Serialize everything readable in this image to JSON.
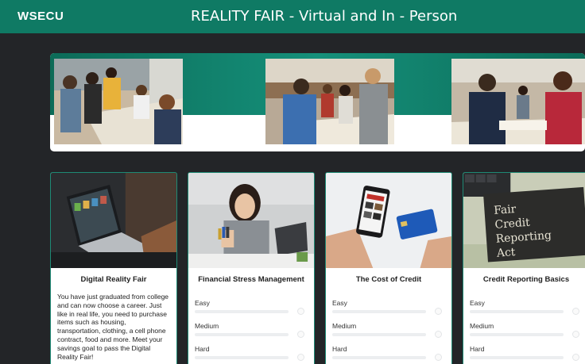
{
  "header": {
    "logo": "WSECU",
    "title": "REALITY FAIR - Virtual and In - Person"
  },
  "colors": {
    "brand_green": "#0f7a64",
    "page_bg": "#232528"
  },
  "banner": {
    "photos": [
      "event-photo-1",
      "event-photo-2",
      "event-photo-3"
    ]
  },
  "cards": [
    {
      "title": "Digital Reality Fair",
      "description": "You have just graduated from college and can now choose a career. Just like in real life, you need to purchase items such as housing, transportation, clothing, a cell phone contract, food and more. Meet your savings goal to pass the Digital Reality Fair!"
    },
    {
      "title": "Financial Stress Management",
      "levels": [
        "Easy",
        "Medium",
        "Hard"
      ]
    },
    {
      "title": "The Cost of Credit",
      "levels": [
        "Easy",
        "Medium",
        "Hard"
      ]
    },
    {
      "title": "Credit Reporting Basics",
      "levels": [
        "Easy",
        "Medium",
        "Hard"
      ],
      "image_text": {
        "line1": "Fair",
        "line2": "Credit",
        "line3": "Reporting",
        "line4": "Act"
      }
    }
  ]
}
